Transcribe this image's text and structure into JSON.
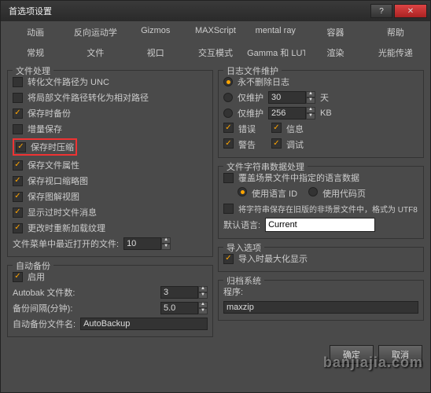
{
  "window": {
    "title": "首选项设置"
  },
  "tabs_row1": [
    "动画",
    "反向运动学",
    "Gizmos",
    "MAXScript",
    "mental ray",
    "容器",
    "帮助"
  ],
  "tabs_row2": [
    "常规",
    "文件",
    "视口",
    "交互模式",
    "Gamma 和 LUT",
    "渲染",
    "光能传递"
  ],
  "left": {
    "grp_file": "文件处理",
    "opts": {
      "unc": "转化文件路径为 UNC",
      "rel": "将局部文件路径转化为相对路径",
      "backup": "保存时备份",
      "incr": "增量保存",
      "compress": "保存时压缩",
      "props": "保存文件属性",
      "thumb": "保存视口缩略图",
      "schematic": "保存图解视图",
      "obsolete": "显示过时文件消息",
      "reload": "更改时重新加载纹理"
    },
    "recent_label": "文件菜单中最近打开的文件:",
    "recent_val": "10",
    "grp_auto": "自动备份",
    "enable": "启用",
    "count_label": "Autobak 文件数:",
    "count_val": "3",
    "interval_label": "备份间隔(分钟):",
    "interval_val": "5.0",
    "name_label": "自动备份文件名:",
    "name_val": "AutoBackup"
  },
  "right": {
    "grp_log": "日志文件维护",
    "never": "永不删除日志",
    "days": "仅维护",
    "days_val": "30",
    "days_unit": "天",
    "kb": "仅维护",
    "kb_val": "256",
    "kb_unit": "KB",
    "err": "错误",
    "info": "信息",
    "warn": "警告",
    "dbg": "调试",
    "grp_str": "文件字符串数据处理",
    "override": "覆盖场景文件中指定的语言数据",
    "langid": "使用语言 ID",
    "codepage": "使用代码页",
    "utf8": "将字符串保存在旧版的非场景文件中，格式为 UTF8",
    "deflang": "默认语言:",
    "deflang_val": "Current",
    "grp_import": "导入选项",
    "maximize": "导入时最大化显示",
    "grp_arch": "归档系统",
    "prog": "程序:",
    "prog_val": "maxzip"
  },
  "footer": {
    "ok": "确定",
    "cancel": "取消"
  },
  "watermark": "banjiajia.com"
}
